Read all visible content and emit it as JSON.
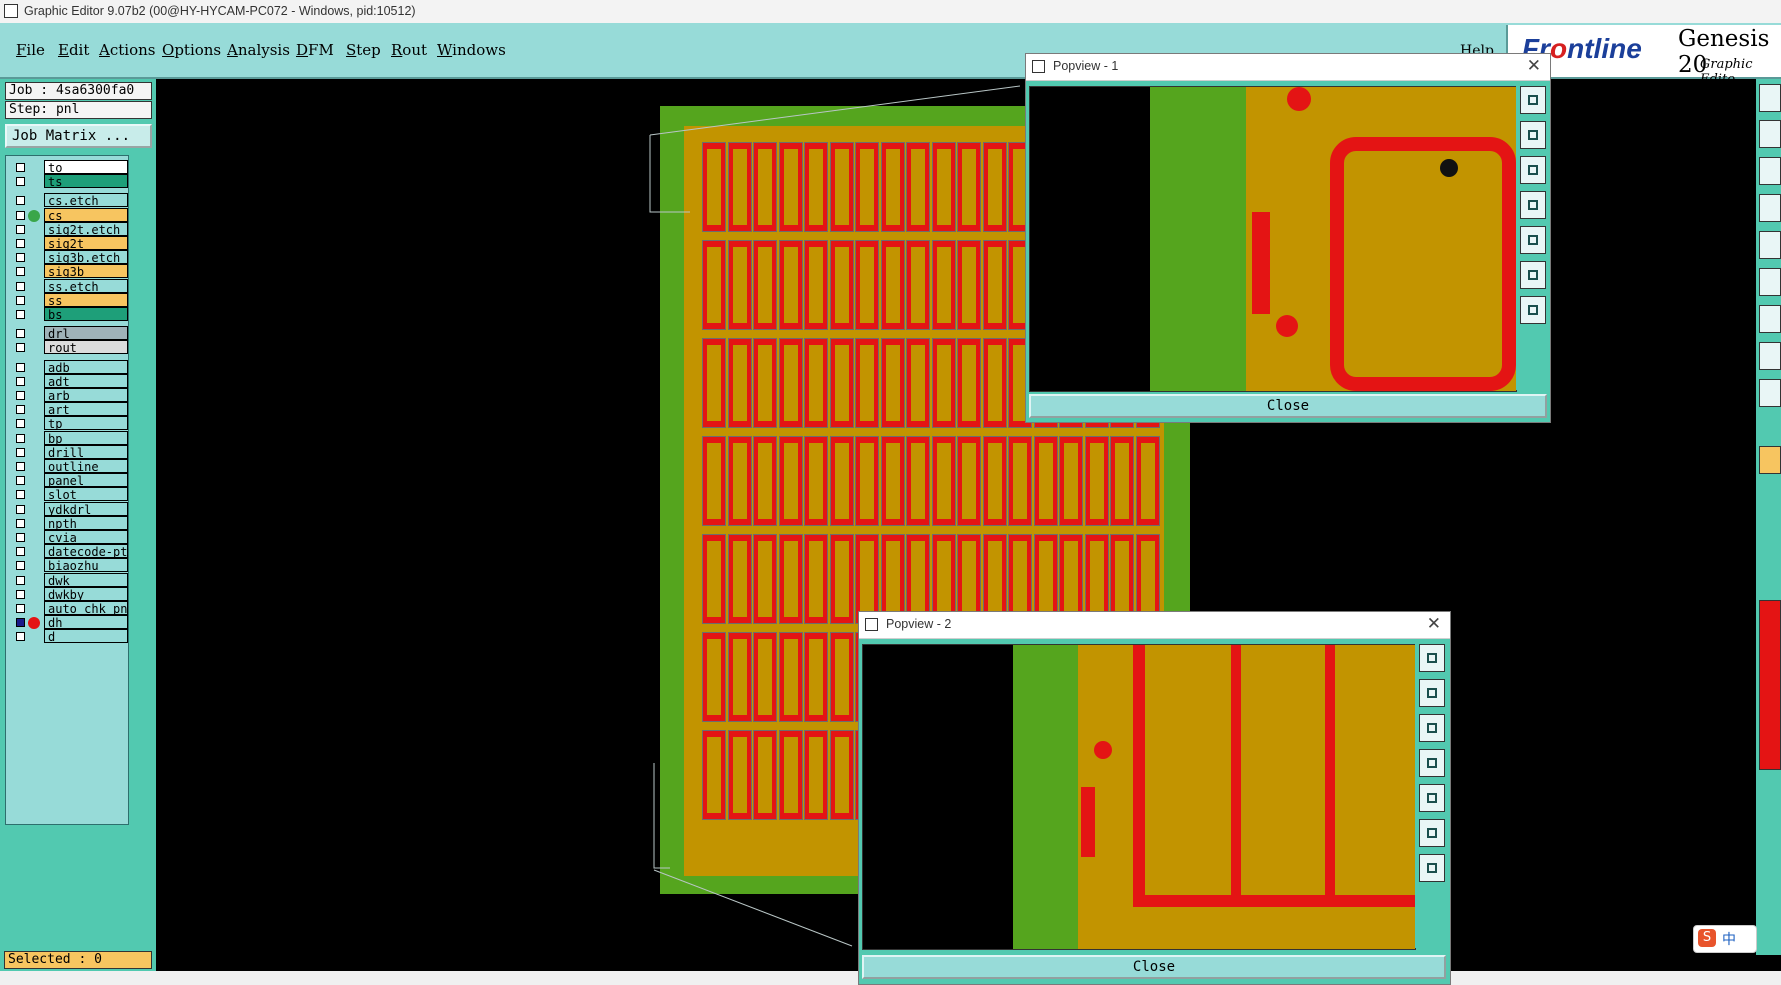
{
  "window": {
    "title": "Graphic Editor 9.07b2 (00@HY-HYCAM-PC072 - Windows, pid:10512)"
  },
  "menu": {
    "items": [
      "File",
      "Edit",
      "Actions",
      "Options",
      "Analysis",
      "DFM",
      "Step",
      "Rout",
      "Windows"
    ],
    "help": "Help"
  },
  "brand": {
    "logo_prefix": "Fr",
    "logo_o": "o",
    "logo_suffix": "ntline",
    "product": "Genesis 20",
    "subtitle": "Graphic Edito"
  },
  "job": {
    "job_line": "Job : 4sa6300fa0",
    "step_line": "Step: pnl",
    "matrix_button": "Job Matrix ..."
  },
  "layers": [
    {
      "name": "to",
      "color": "#ffffff",
      "checked": false
    },
    {
      "name": "ts",
      "color": "#1e9f79",
      "checked": false
    },
    {
      "name": "cs.etch",
      "color": "#97dbd8",
      "checked": false
    },
    {
      "name": "cs",
      "color": "#f7c560",
      "checked": false,
      "dot": "#3aa64a"
    },
    {
      "name": "sig2t.etch",
      "color": "#97dbd8",
      "checked": false
    },
    {
      "name": "sig2t",
      "color": "#f7c560",
      "checked": false
    },
    {
      "name": "sig3b.etch",
      "color": "#97dbd8",
      "checked": false
    },
    {
      "name": "sig3b",
      "color": "#f7c560",
      "checked": false
    },
    {
      "name": "ss.etch",
      "color": "#97dbd8",
      "checked": false
    },
    {
      "name": "ss",
      "color": "#f7c560",
      "checked": false
    },
    {
      "name": "bs",
      "color": "#1e9f79",
      "checked": false
    },
    {
      "name": "drl",
      "color": "#9fb2b8",
      "checked": false
    },
    {
      "name": "rout",
      "color": "#dcdcdc",
      "checked": false
    },
    {
      "name": "adb",
      "color": "#97dbd8",
      "checked": false
    },
    {
      "name": "adt",
      "color": "#97dbd8",
      "checked": false
    },
    {
      "name": "arb",
      "color": "#97dbd8",
      "checked": false
    },
    {
      "name": "art",
      "color": "#97dbd8",
      "checked": false
    },
    {
      "name": "tp",
      "color": "#97dbd8",
      "checked": false
    },
    {
      "name": "bp",
      "color": "#97dbd8",
      "checked": false
    },
    {
      "name": "drill",
      "color": "#97dbd8",
      "checked": false
    },
    {
      "name": "outline",
      "color": "#97dbd8",
      "checked": false
    },
    {
      "name": "panel",
      "color": "#97dbd8",
      "checked": false
    },
    {
      "name": "slot",
      "color": "#97dbd8",
      "checked": false
    },
    {
      "name": "ydkdrl",
      "color": "#97dbd8",
      "checked": false
    },
    {
      "name": "npth",
      "color": "#97dbd8",
      "checked": false
    },
    {
      "name": "cvia",
      "color": "#97dbd8",
      "checked": false
    },
    {
      "name": "datecode-pte",
      "color": "#97dbd8",
      "checked": false
    },
    {
      "name": "biaozhu",
      "color": "#97dbd8",
      "checked": false
    },
    {
      "name": "dwk",
      "color": "#97dbd8",
      "checked": false
    },
    {
      "name": "dwkby",
      "color": "#97dbd8",
      "checked": false
    },
    {
      "name": "auto_chk_pnl",
      "color": "#97dbd8",
      "checked": false
    },
    {
      "name": "dh",
      "color": "#97dbd8",
      "checked": true,
      "dot": "#e41414"
    },
    {
      "name": "d",
      "color": "#97dbd8",
      "checked": false
    }
  ],
  "status": {
    "selected": "Selected : 0"
  },
  "popview1": {
    "title": "Popview - 1",
    "close_label": "Close"
  },
  "popview2": {
    "title": "Popview - 2",
    "close_label": "Close"
  },
  "ime": {
    "label": "中"
  },
  "colors": {
    "board_green": "#55a51e",
    "copper": "#c29400",
    "trace_red": "#e41414",
    "panel_teal": "#52c9b0",
    "menu_teal": "#97dbd8"
  }
}
